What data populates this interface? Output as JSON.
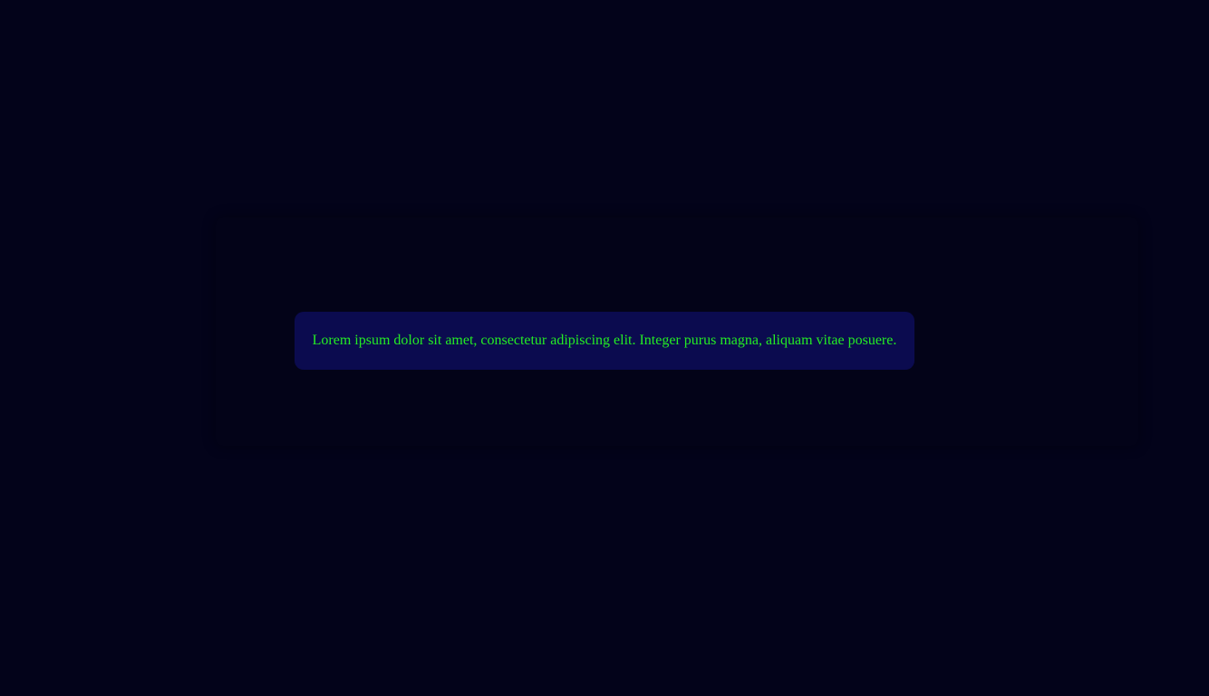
{
  "theme": {
    "background_color": "#03031a",
    "panel_color": "#030318",
    "message_background_color": "#0b0b4f",
    "message_text_color": "#24ec24"
  },
  "notification": {
    "text": "Lorem ipsum dolor sit amet, consectetur adipiscing elit. Integer purus magna, aliquam vitae posuere."
  }
}
